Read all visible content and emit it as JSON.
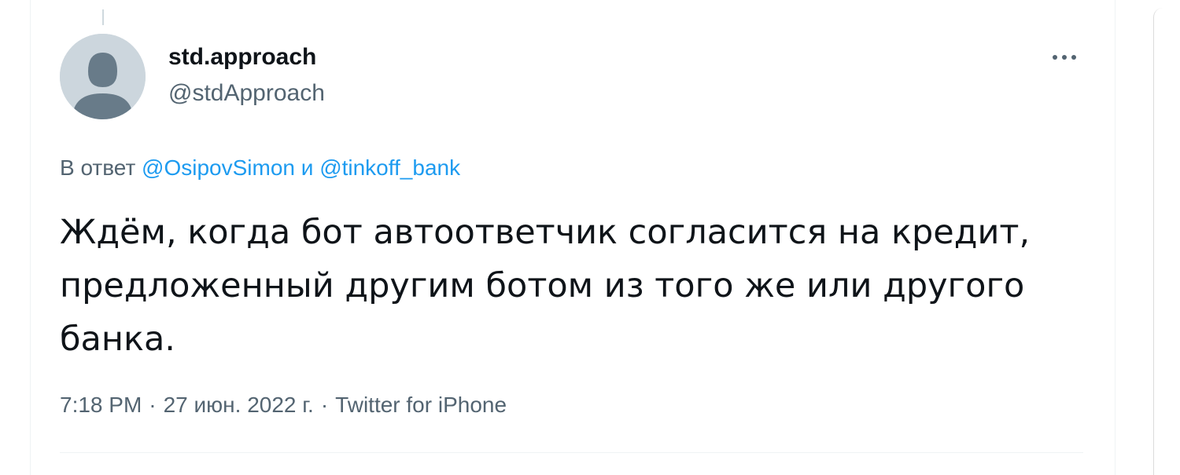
{
  "tweet": {
    "display_name": "std.approach",
    "username": "@stdApproach",
    "reply_prefix": "В ответ",
    "reply_mention_1": "@OsipovSimon",
    "reply_conjunction": "и",
    "reply_mention_2": "@tinkoff_bank",
    "text": "Ждём, когда бот автоответчик согласится на кредит, предложенный другим ботом из того же или другого банка.",
    "time": "7:18 PM",
    "date": "27 июн. 2022 г.",
    "separator": "·",
    "source": "Twitter for iPhone"
  },
  "icons": {
    "avatar": "default-avatar-icon",
    "more": "more-horizontal-icon"
  },
  "colors": {
    "link": "#1d9bf0",
    "secondary_text": "#536471",
    "primary_text": "#0f1419",
    "avatar_bg": "#ccd6dd",
    "avatar_fg": "#687b89"
  }
}
